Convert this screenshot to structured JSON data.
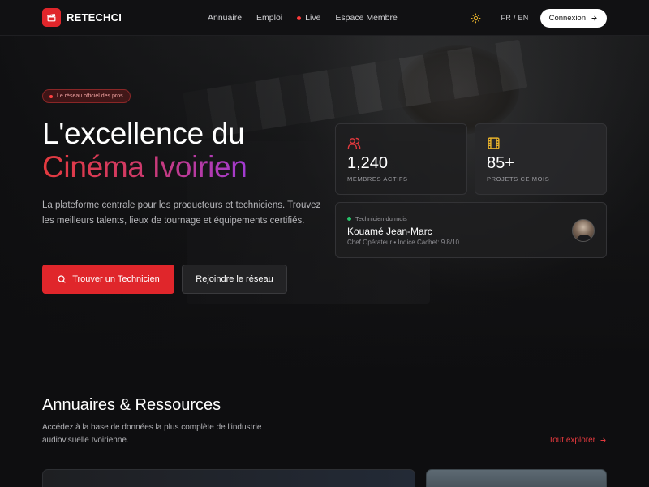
{
  "colors": {
    "accent": "#e0262b",
    "gradient_start": "#e43a3e",
    "gradient_end": "#a23bd4",
    "live": "#ff3b3b",
    "online": "#27c36a",
    "gold": "#e6b12b"
  },
  "header": {
    "brand": "RETECHCI",
    "logo_icon": "clapperboard-icon",
    "nav": [
      {
        "label": "Annuaire"
      },
      {
        "label": "Emploi"
      },
      {
        "label": "Live"
      },
      {
        "label": "Espace Membre"
      }
    ],
    "theme_icon": "sun-icon",
    "language": "FR / EN",
    "login_label": "Connexion",
    "login_icon": "arrow-right-icon"
  },
  "hero": {
    "badge": "Le réseau officiel des pros",
    "title_line1": "L'excellence du",
    "title_line2": "Cinéma Ivoirien",
    "description": "La plateforme centrale pour les producteurs et techniciens. Trouvez les meilleurs talents, lieux de tournage et équipements certifiés.",
    "primary_button": "Trouver un Technicien",
    "primary_icon": "search-icon",
    "secondary_button": "Rejoindre le réseau"
  },
  "stats": [
    {
      "value": "1,240",
      "label": "MEMBRES ACTIFS",
      "icon": "users-icon"
    },
    {
      "value": "85+",
      "label": "PROJETS CE MOIS",
      "icon": "film-icon"
    }
  ],
  "featured_technician": {
    "eyebrow": "Technicien du mois",
    "name": "Kouamé Jean-Marc",
    "subtitle": "Chef Opérateur • Indice Cachet: 9.8/10"
  },
  "directory": {
    "title": "Annuaires & Ressources",
    "description": "Accédez à la base de données la plus complète de l'industrie audiovisuelle Ivoirienne.",
    "explore_label": "Tout explorer",
    "explore_icon": "arrow-right-icon"
  }
}
